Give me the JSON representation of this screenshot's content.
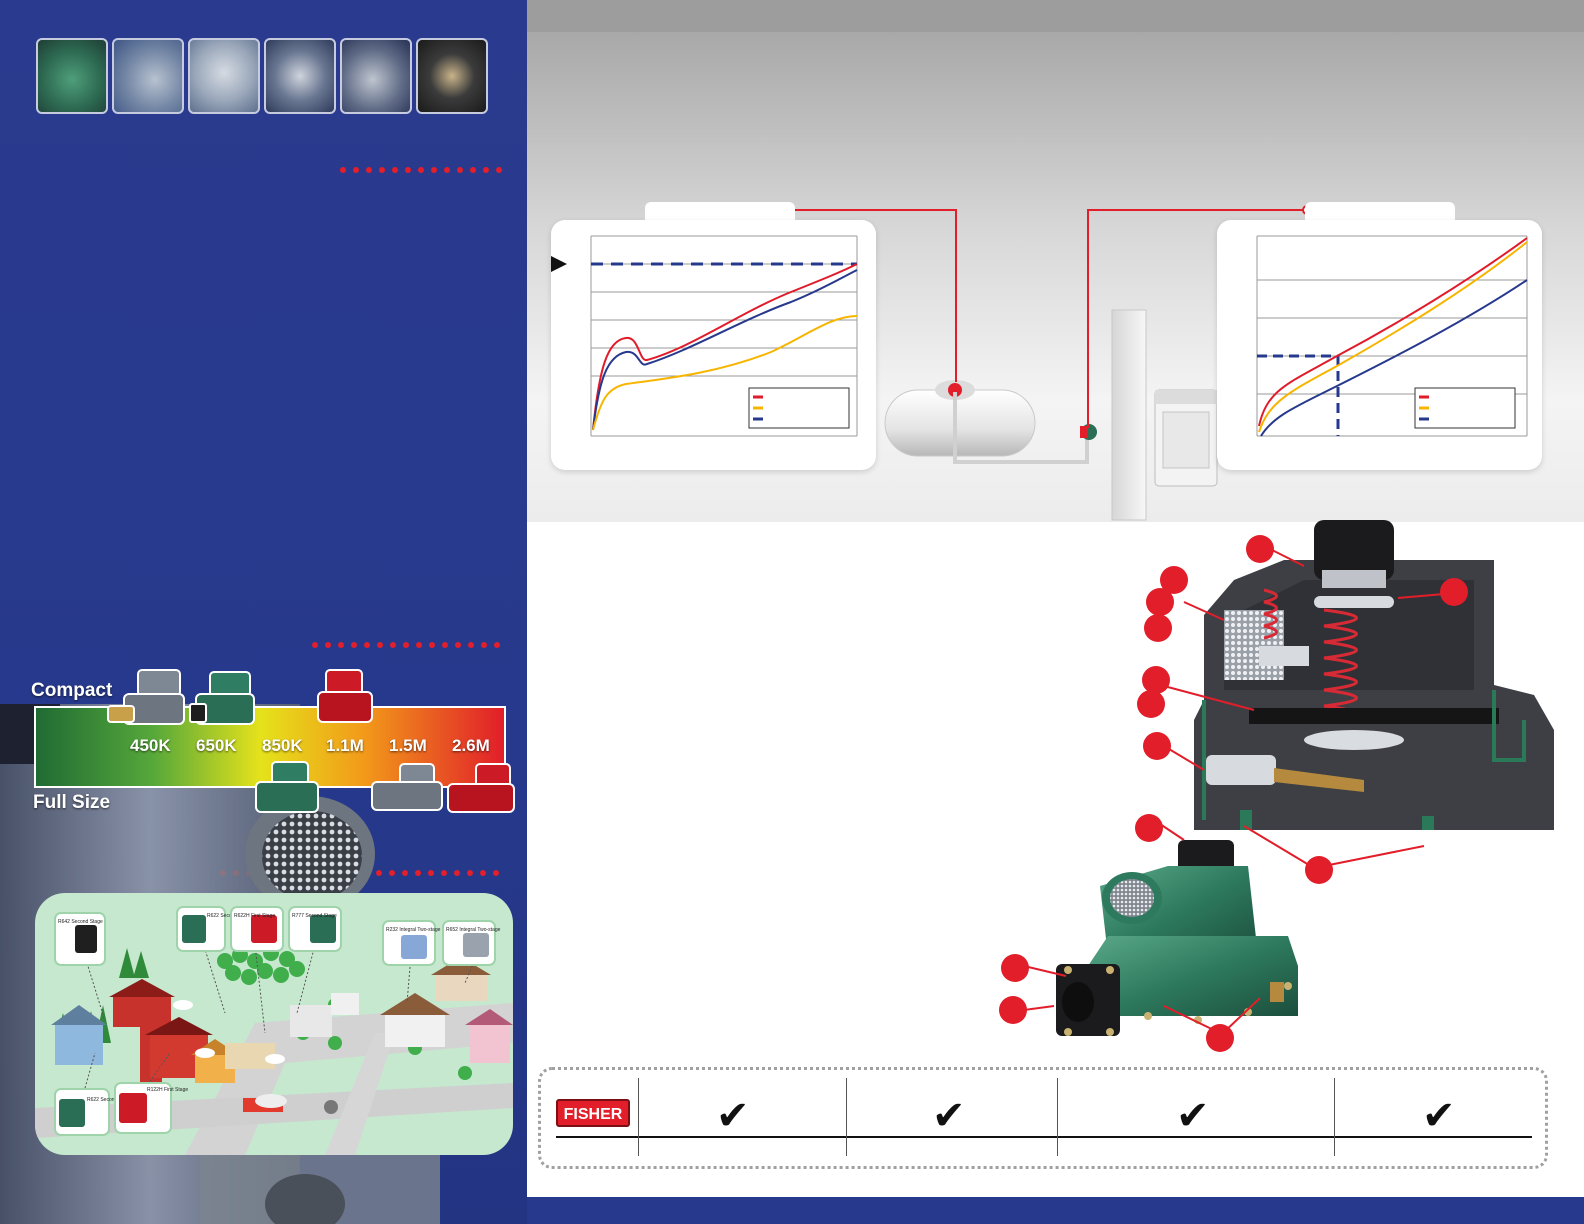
{
  "capacity_scale": {
    "compact_label": "Compact",
    "full_size_label": "Full Size",
    "values": [
      "450K",
      "650K",
      "850K",
      "1.1M",
      "1.5M",
      "2.6M"
    ]
  },
  "map_labels": {
    "r642": "R642 Second Stage",
    "r622": "R622 Second Stage",
    "r622h": "R622H First Stage",
    "r777": "R777 Second Stage",
    "r232": "R232 Integral Two-stage",
    "r652": "R652 Integral Two-stage",
    "r622b": "R622 Second Stage",
    "r122h": "R122H First Stage"
  },
  "comparison": {
    "logo": "FISHER",
    "check_glyph": "✔"
  },
  "colors": {
    "brand_blue": "#27398c",
    "accent_red": "#e11e2a",
    "series_red": "#e01b2a",
    "series_yellow": "#f7b500",
    "series_blue": "#27398c"
  }
}
